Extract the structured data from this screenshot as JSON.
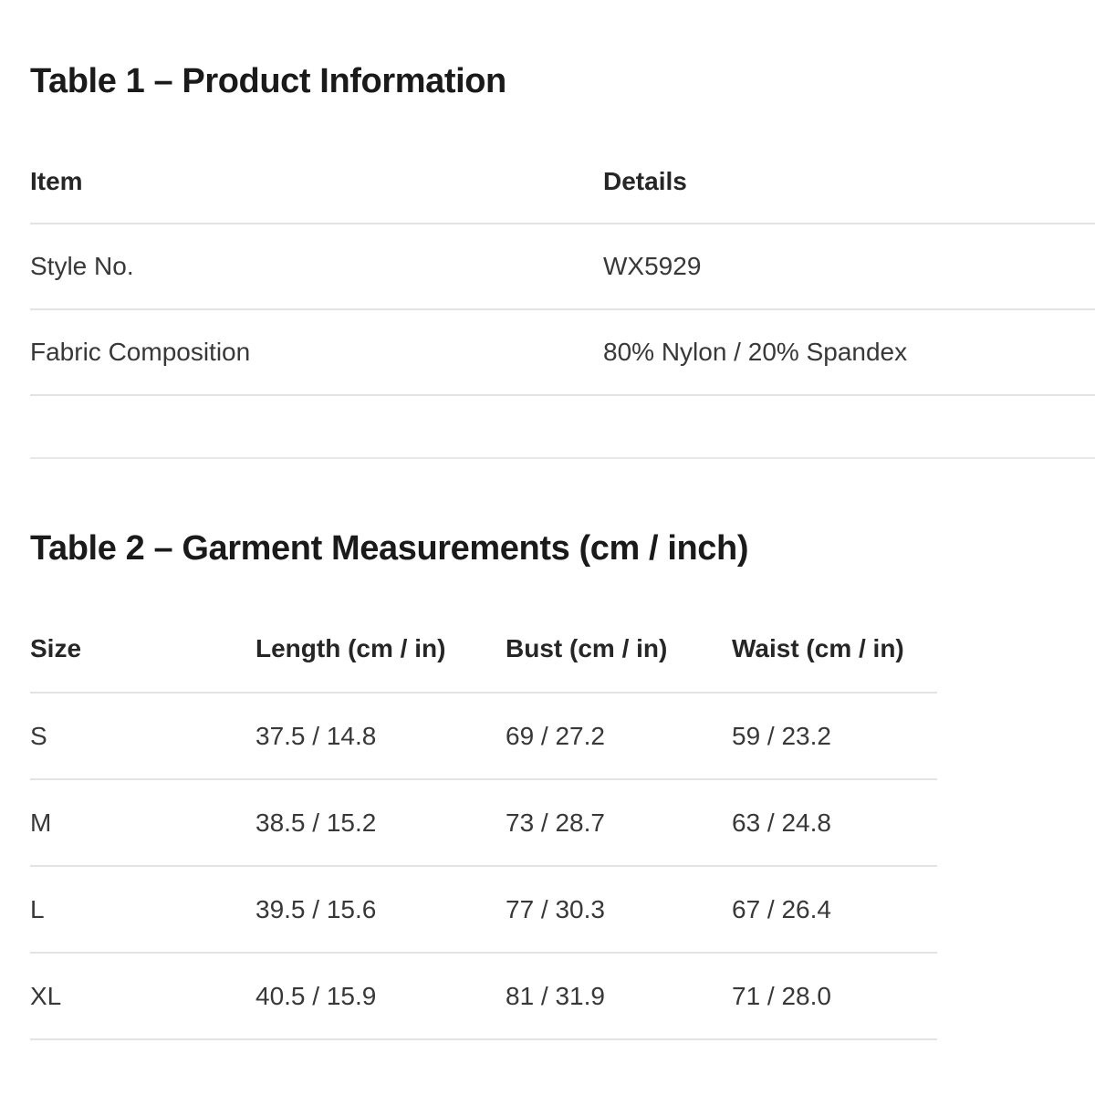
{
  "table1": {
    "title": "Table 1 – Product Information",
    "headers": [
      "Item",
      "Details"
    ],
    "rows": [
      [
        "Style No.",
        "WX5929"
      ],
      [
        "Fabric Composition",
        "80% Nylon / 20% Spandex"
      ]
    ]
  },
  "table2": {
    "title": "Table 2 – Garment Measurements (cm / inch)",
    "headers": [
      "Size",
      "Length (cm / in)",
      "Bust (cm / in)",
      "Waist (cm / in)"
    ],
    "rows": [
      [
        "S",
        "37.5 / 14.8",
        "69 / 27.2",
        "59 / 23.2"
      ],
      [
        "M",
        "38.5 / 15.2",
        "73 / 28.7",
        "63 / 24.8"
      ],
      [
        "L",
        "39.5 / 15.6",
        "77 / 30.3",
        "67 / 26.4"
      ],
      [
        "XL",
        "40.5 / 15.9",
        "81 / 31.9",
        "71 / 28.0"
      ]
    ]
  }
}
